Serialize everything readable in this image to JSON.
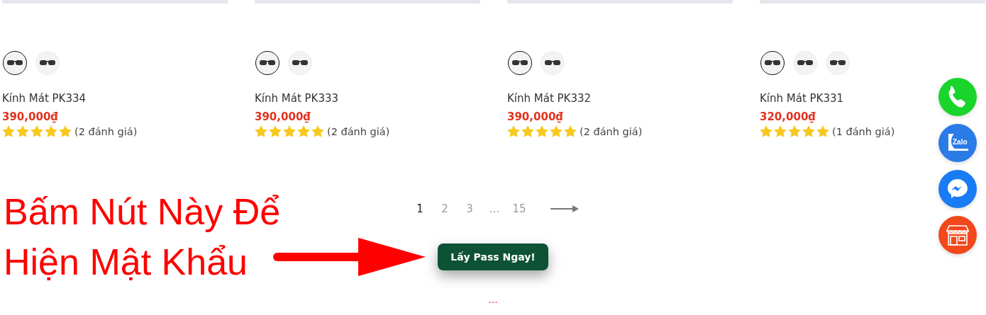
{
  "products": [
    {
      "name": "Kính Mát PK334",
      "price": "390,000₫",
      "stars": 5,
      "reviews": "(2 đánh giá)",
      "swatches": [
        {
          "selected": true
        },
        {
          "selected": false
        }
      ]
    },
    {
      "name": "Kính Mát PK333",
      "price": "390,000₫",
      "stars": 5,
      "reviews": "(2 đánh giá)",
      "swatches": [
        {
          "selected": true
        },
        {
          "selected": false
        }
      ]
    },
    {
      "name": "Kính Mát PK332",
      "price": "390,000₫",
      "stars": 5,
      "reviews": "(2 đánh giá)",
      "swatches": [
        {
          "selected": true
        },
        {
          "selected": false
        }
      ]
    },
    {
      "name": "Kính Mát PK331",
      "price": "320,000₫",
      "stars": 5,
      "reviews": "(1 đánh giá)",
      "swatches": [
        {
          "selected": true
        },
        {
          "selected": false
        },
        {
          "selected": false
        }
      ]
    }
  ],
  "pagination": {
    "pages": [
      {
        "label": "1",
        "selected": true
      },
      {
        "label": "2",
        "selected": false
      },
      {
        "label": "3",
        "selected": false
      },
      {
        "label": "…",
        "selected": false
      },
      {
        "label": "15",
        "selected": false
      }
    ]
  },
  "annotation": {
    "lines": [
      "Bấm Nút Này Để",
      "Hiện Mật Khẩu"
    ]
  },
  "get_pass_button": {
    "label": "Lấy Pass Ngay!"
  },
  "loading": "...",
  "contact_buttons": [
    {
      "kind": "phone"
    },
    {
      "kind": "zalo",
      "label": "Zalo"
    },
    {
      "kind": "messenger"
    },
    {
      "kind": "store"
    }
  ]
}
